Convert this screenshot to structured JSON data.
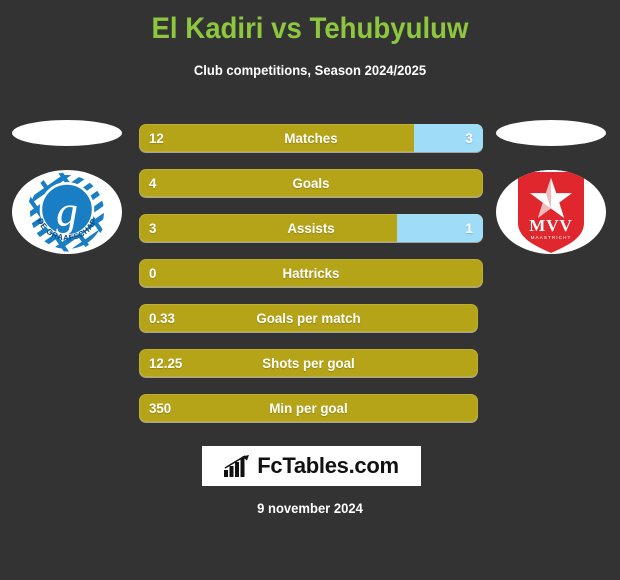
{
  "header": {
    "title": "El Kadiri vs Tehubyuluw",
    "subtitle": "Club competitions, Season 2024/2025",
    "title_color": "#8dc63f"
  },
  "teams": {
    "home": {
      "crest_name": "de-graafschap-crest",
      "crest_text": "DE GRAAFSCHAP",
      "crest_monogram": "g",
      "primary_color": "#1a7ec4",
      "secondary_color": "#0b4c86"
    },
    "away": {
      "crest_name": "mvv-maastricht-crest",
      "crest_text": "MVV",
      "crest_subtext": "MAASTRICHT",
      "primary_color": "#e1272e",
      "secondary_color": "#ffffff"
    }
  },
  "colors": {
    "background": "#333333",
    "home_bar": "#b5a318",
    "away_bar": "#9fdcf7",
    "text": "#ffffff"
  },
  "stats": [
    {
      "label": "Matches",
      "home": "12",
      "away": "3",
      "home_pct": 80,
      "away_pct": 20,
      "short": false
    },
    {
      "label": "Goals",
      "home": "4",
      "away": "",
      "home_pct": 100,
      "away_pct": 0,
      "short": false
    },
    {
      "label": "Assists",
      "home": "3",
      "away": "1",
      "home_pct": 75,
      "away_pct": 25,
      "short": false
    },
    {
      "label": "Hattricks",
      "home": "0",
      "away": "",
      "home_pct": 100,
      "away_pct": 0,
      "short": false
    },
    {
      "label": "Goals per match",
      "home": "0.33",
      "away": "",
      "home_pct": 100,
      "away_pct": 0,
      "short": true
    },
    {
      "label": "Shots per goal",
      "home": "12.25",
      "away": "",
      "home_pct": 100,
      "away_pct": 0,
      "short": true
    },
    {
      "label": "Min per goal",
      "home": "350",
      "away": "",
      "home_pct": 100,
      "away_pct": 0,
      "short": true
    }
  ],
  "footer": {
    "brand": "FcTables.com",
    "brand_icon": "bar-chart-icon",
    "date": "9 november 2024"
  }
}
